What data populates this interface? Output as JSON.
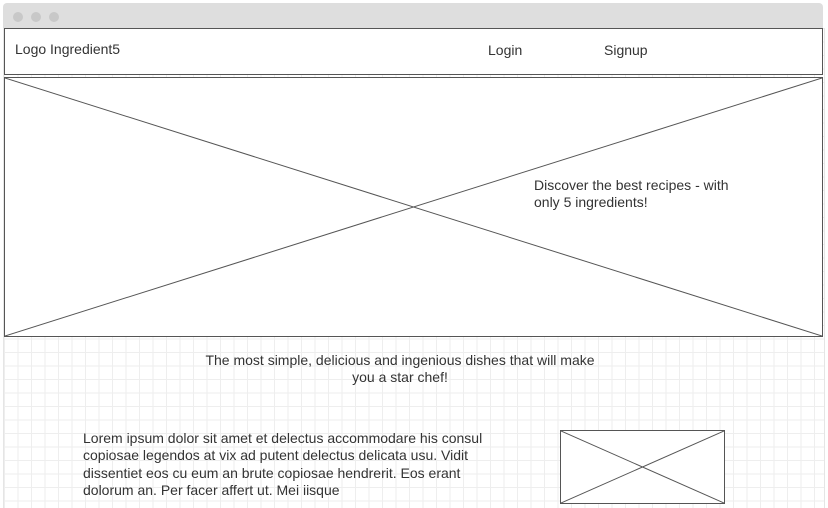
{
  "header": {
    "logo_text": "Logo Ingredient5",
    "nav": {
      "login_label": "Login",
      "signup_label": "Signup"
    }
  },
  "hero": {
    "text": "Discover the best recipes - with only 5 ingredients!"
  },
  "tagline": "The most simple, delicious and ingenious dishes that will make you a star chef!",
  "content": {
    "paragraph": "Lorem ipsum dolor sit amet et delectus accommodare his consul copiosae legendos at vix ad putent delectus delicata usu. Vidit dissentiet eos cu eum an brute copiosae hendrerit. Eos erant dolorum an. Per facer affert ut. Mei iisque"
  },
  "colors": {
    "line": "#555555",
    "text": "#333333",
    "titlebar": "#dedede"
  }
}
